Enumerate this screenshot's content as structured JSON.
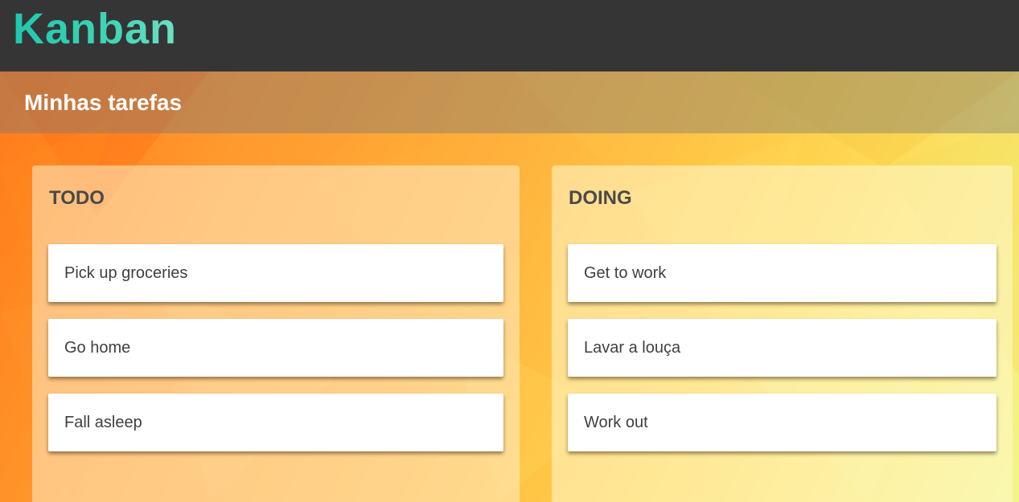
{
  "app": {
    "title": "Kanban"
  },
  "board": {
    "title": "Minhas tarefas"
  },
  "columns": [
    {
      "title": "TODO",
      "cards": [
        "Pick up groceries",
        "Go home",
        "Fall asleep"
      ]
    },
    {
      "title": "DOING",
      "cards": [
        "Get to work",
        "Lavar a louça",
        "Work out"
      ]
    }
  ],
  "colors": {
    "header_bg": "#353535",
    "logo_accent": "#2ccbb3",
    "background_start": "#ff7a1a",
    "background_end": "#f3f58a"
  }
}
